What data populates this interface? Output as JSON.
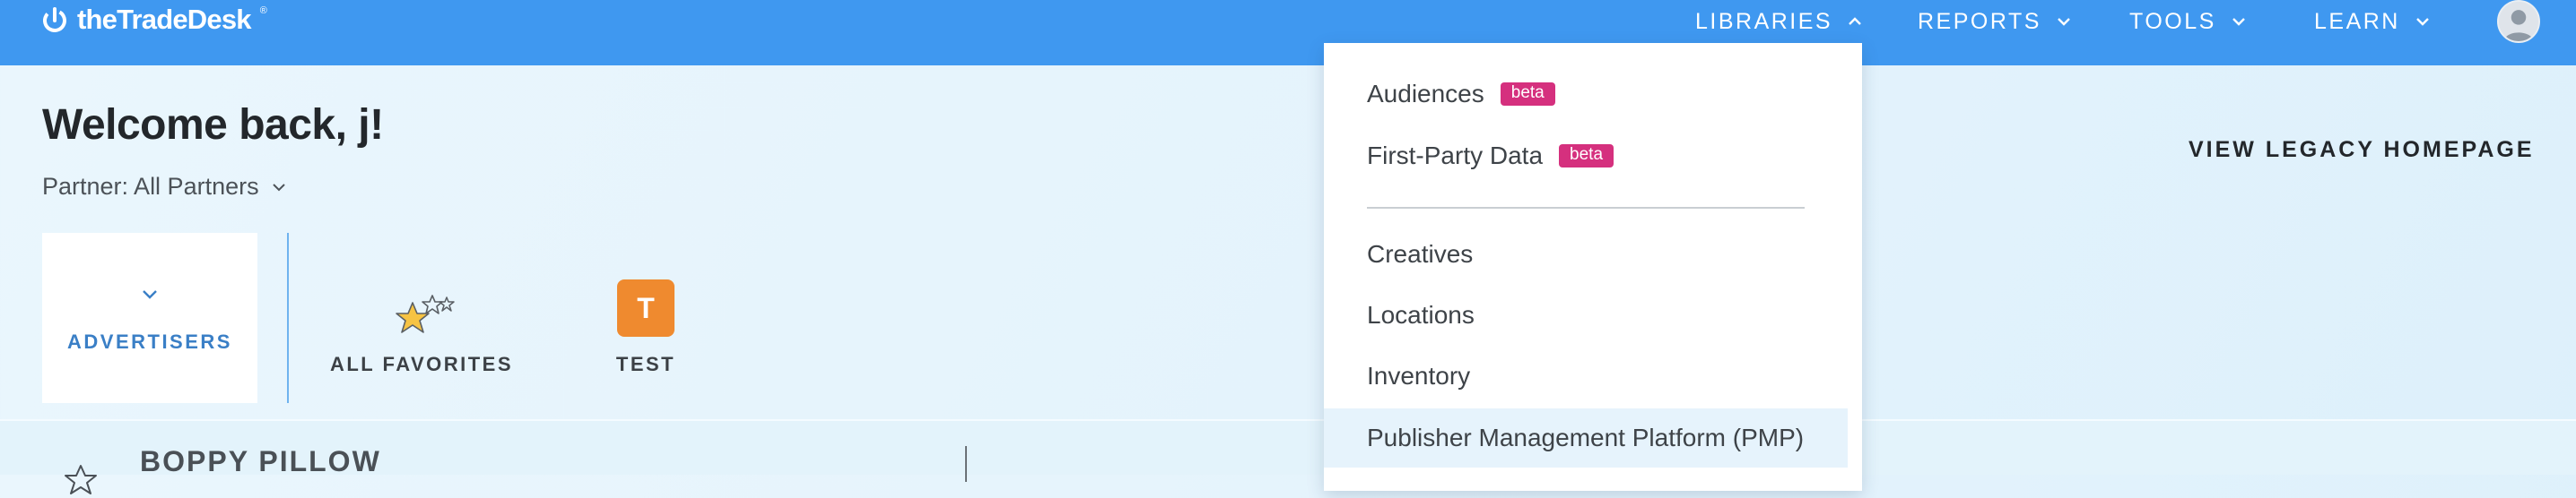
{
  "header": {
    "logo_text": "theTradeDesk",
    "logo_tm": "®",
    "nav": [
      {
        "label": "LIBRARIES",
        "open": true
      },
      {
        "label": "REPORTS",
        "open": false
      },
      {
        "label": "TOOLS",
        "open": false
      },
      {
        "label": "LEARN",
        "open": false
      }
    ]
  },
  "welcome": {
    "title": "Welcome back, j!",
    "partner_label": "Partner: All Partners",
    "legacy_link": "VIEW LEGACY HOMEPAGE"
  },
  "tiles": {
    "advertisers": "ADVERTISERS",
    "favorites": "ALL FAVORITES",
    "test": "TEST",
    "test_initial": "T"
  },
  "list": {
    "first_row_title": "BOPPY PILLOW"
  },
  "libraries_menu": {
    "items": [
      {
        "label": "Audiences",
        "badge": "beta"
      },
      {
        "label": "First-Party Data",
        "badge": "beta"
      },
      {
        "label": "Creatives"
      },
      {
        "label": "Locations"
      },
      {
        "label": "Inventory"
      },
      {
        "label": "Publisher Management Platform (PMP)",
        "highlighted": true
      }
    ]
  },
  "colors": {
    "topbar": "#3f98f0",
    "beta_badge": "#d5307e",
    "test_badge": "#ef8a2f",
    "advertisers_accent": "#3a7fc6"
  }
}
